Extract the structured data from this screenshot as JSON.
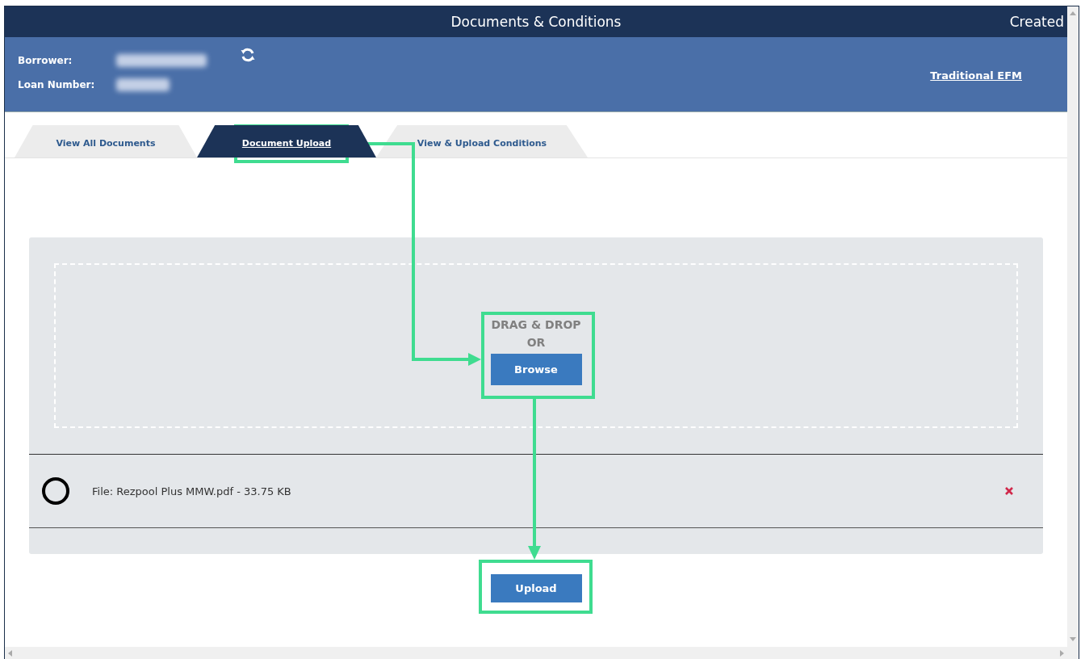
{
  "window": {
    "title": "Documents & Conditions",
    "status": "Created"
  },
  "header": {
    "fields": [
      {
        "label": "Borrower:"
      },
      {
        "label": "Loan Number:"
      }
    ],
    "link": "Traditional EFM"
  },
  "tabs": [
    {
      "label": "View All Documents",
      "selected": false
    },
    {
      "label": "Document Upload",
      "selected": true
    },
    {
      "label": "View & Upload Conditions",
      "selected": false
    }
  ],
  "dropzone": {
    "title": "DRAG & DROP",
    "or": "OR",
    "browse": "Browse"
  },
  "files": [
    {
      "text": "File: Rezpool Plus MMW.pdf - 33.75 KB"
    }
  ],
  "upload": "Upload"
}
